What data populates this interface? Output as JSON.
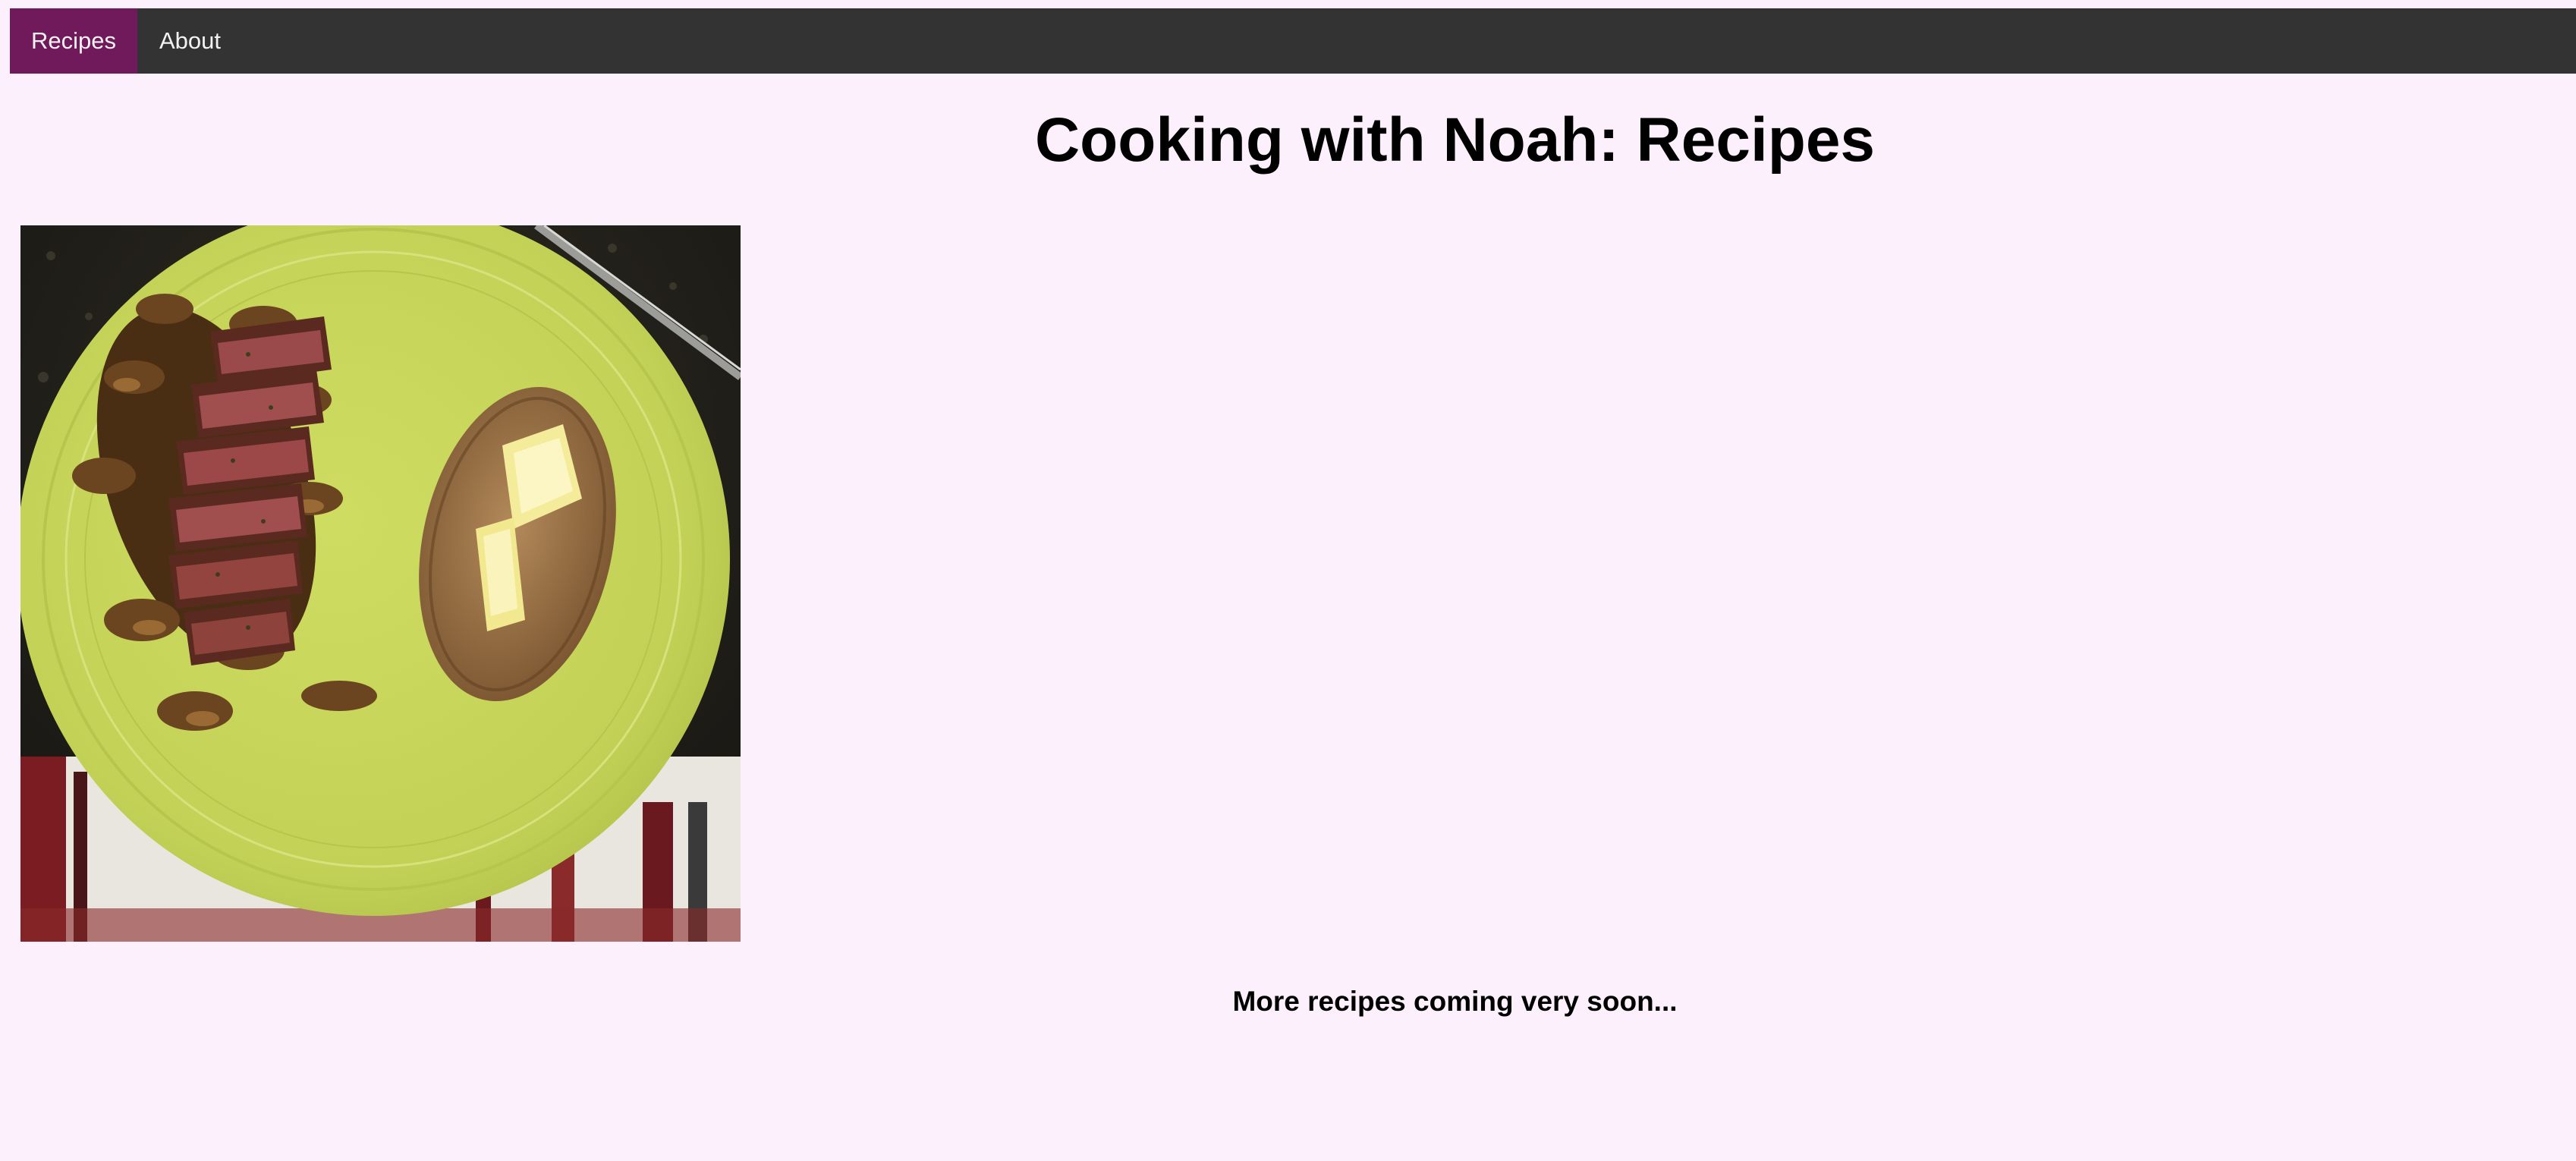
{
  "nav": {
    "items": [
      {
        "label": "Recipes",
        "active": true
      },
      {
        "label": "About",
        "active": false
      }
    ]
  },
  "page": {
    "title": "Cooking with Noah: Recipes",
    "footer_note": "More recipes coming very soon..."
  },
  "photo": {
    "alt": "Sliced steak with mushrooms and a buttered baked potato on a green plate"
  },
  "colors": {
    "background": "#fcf0fc",
    "navbar": "#333333",
    "nav_active": "#701a5c",
    "nav_text": "#f2f2f2",
    "plate": "#c8d85a"
  }
}
